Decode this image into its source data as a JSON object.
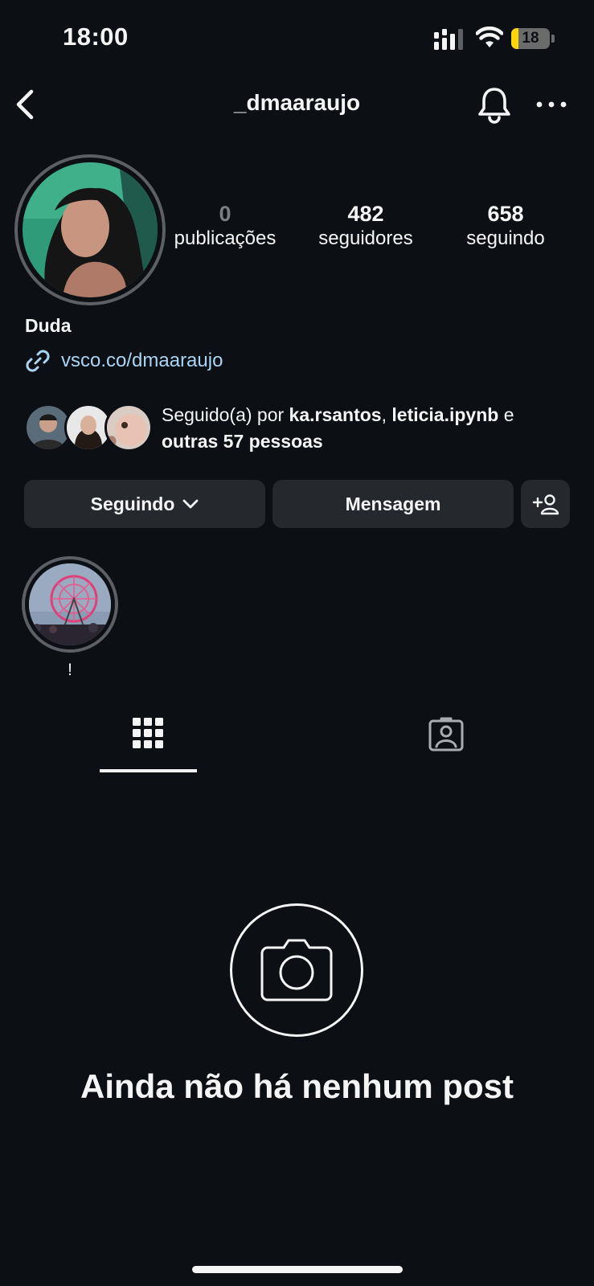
{
  "status_bar": {
    "time": "18:00",
    "battery_level": "18",
    "battery_fraction": 0.18,
    "battery_color": "#ffd60a",
    "signal_icon": "cellular-signal-icon",
    "wifi_icon": "wifi-icon"
  },
  "header": {
    "username": "_dmaaraujo",
    "back_icon": "chevron-left-icon",
    "bell_icon": "bell-icon",
    "more_icon": "ellipsis-icon"
  },
  "profile": {
    "display_name": "Duda",
    "link": "vsco.co/dmaaraujo",
    "link_color": "#a8d4f5"
  },
  "stats": [
    {
      "count": "0",
      "label": "publicações"
    },
    {
      "count": "482",
      "label": "seguidores"
    },
    {
      "count": "658",
      "label": "seguindo"
    }
  ],
  "followed_by": {
    "prefix": "Seguido(a) por ",
    "user1": "ka.rsantos",
    "sep": ", ",
    "user2": "leticia.ipynb",
    "conj": " e",
    "others": "outras 57 pessoas"
  },
  "actions": {
    "following_label": "Seguindo",
    "message_label": "Mensagem"
  },
  "highlights": [
    {
      "label": "!"
    }
  ],
  "tabs": [
    {
      "icon": "grid-icon",
      "active": true
    },
    {
      "icon": "tagged-person-icon",
      "active": false
    }
  ],
  "empty_state": {
    "icon": "camera-icon",
    "title": "Ainda não há nenhum post"
  },
  "colors": {
    "background": "#0c1014",
    "button_bg": "#25292e",
    "text": "#f5f5f5"
  }
}
